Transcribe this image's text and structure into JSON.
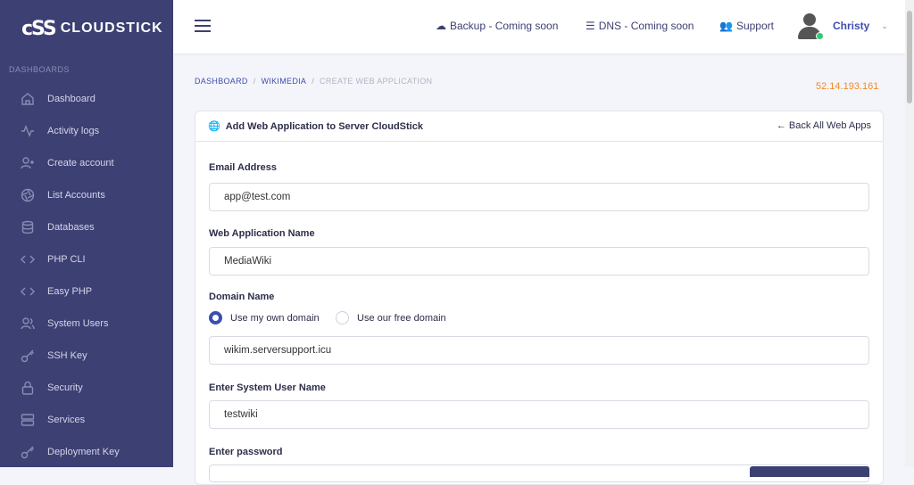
{
  "app": {
    "brand": "CLOUDSTICK",
    "brand_mark": "cSS"
  },
  "sidebar": {
    "section": "DASHBOARDS",
    "items": [
      {
        "label": "Dashboard",
        "icon": "home-icon"
      },
      {
        "label": "Activity logs",
        "icon": "activity-icon"
      },
      {
        "label": "Create account",
        "icon": "user-add-icon"
      },
      {
        "label": "List Accounts",
        "icon": "aperture-icon"
      },
      {
        "label": "Databases",
        "icon": "database-icon"
      },
      {
        "label": "PHP CLI",
        "icon": "code-icon"
      },
      {
        "label": "Easy PHP",
        "icon": "code-icon"
      },
      {
        "label": "System Users",
        "icon": "users-icon"
      },
      {
        "label": "SSH Key",
        "icon": "key-icon"
      },
      {
        "label": "Security",
        "icon": "lock-icon"
      },
      {
        "label": "Services",
        "icon": "server-icon"
      },
      {
        "label": "Deployment Key",
        "icon": "key-icon"
      }
    ]
  },
  "topbar": {
    "backup": "Backup - Coming soon",
    "dns": "DNS - Coming soon",
    "support": "Support",
    "user": "Christy"
  },
  "breadcrumb": {
    "home": "DASHBOARD",
    "parent": "WIKIMEDIA",
    "current": "CREATE WEB APPLICATION"
  },
  "server_ip": "52.14.193.161",
  "card": {
    "title": "Add Web Application to Server CloudStick",
    "back": "Back All Web Apps"
  },
  "form": {
    "email_label": "Email Address",
    "email_value": "app@test.com",
    "app_name_label": "Web Application Name",
    "app_name_value": "MediaWiki",
    "domain_label": "Domain Name",
    "domain_opt_own": "Use my own domain",
    "domain_opt_free": "Use our free domain",
    "domain_value": "wikim.serversupport.icu",
    "sys_user_label": "Enter System User Name",
    "sys_user_value": "testwiki",
    "password_label": "Enter password"
  }
}
